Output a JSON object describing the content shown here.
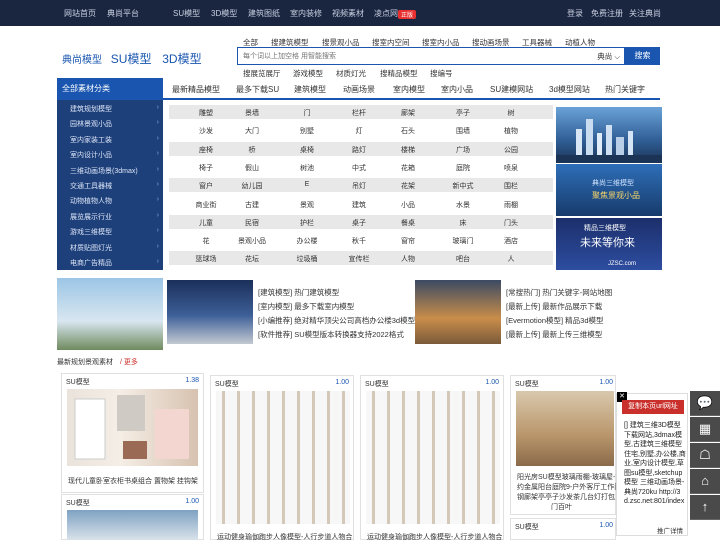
{
  "topbar": {
    "links": [
      "网站首页",
      "典尚平台",
      "SU模型",
      "3D模型",
      "建筑图纸",
      "室内装修",
      "视频素材",
      "凌点网"
    ],
    "hot_badge": "正版",
    "right": [
      "登录",
      "免费注册",
      "关注典尚"
    ]
  },
  "logo": {
    "brand": "典尚模型",
    "su": "SU模型",
    "d3": "3D模型"
  },
  "search": {
    "categories": [
      "全部",
      "搜建筑模型",
      "搜景观小品",
      "搜室内空间",
      "搜室内小品",
      "搜动画场景",
      "工具器械",
      "动植人物"
    ],
    "placeholder": "每个词以上加空格 用智能搜索",
    "select": "典尚",
    "button": "搜索",
    "sub": [
      "搜展览展厅",
      "游戏模型",
      "材质灯光",
      "搜精品模型",
      "搜编号"
    ]
  },
  "nav": {
    "all": "全部素材分类",
    "items": [
      "最新精品模型",
      "最多下载SU",
      "建筑模型",
      "动画场景",
      "室内模型",
      "室内小品",
      "SU建模网站",
      "3d模型网站",
      "热门关键字"
    ]
  },
  "sidebar": [
    "建筑规划模型",
    "园林景观小品",
    "室内家装工装",
    "室内设计小品",
    "三维动画场景(3dmax)",
    "交通工具器械",
    "动物植物人物",
    "展览展示行业",
    "游戏三维模型",
    "材质贴图灯光",
    "电商广告精品"
  ],
  "tags": [
    [
      "雕塑",
      "景墙",
      "门",
      "栏杆",
      "廊架",
      "亭子",
      "树"
    ],
    [
      "沙发",
      "大门",
      "别墅",
      "灯",
      "石头",
      "围墙",
      "植物"
    ],
    [
      "座椅",
      "桥",
      "桌椅",
      "路灯",
      "楼梯",
      "广场",
      "公园"
    ],
    [
      "椅子",
      "假山",
      "树池",
      "中式",
      "花箱",
      "庭院",
      "喷泉"
    ],
    [
      "窗户",
      "幼儿园",
      "E",
      "吊灯",
      "花架",
      "新中式",
      "围栏"
    ],
    [
      "商业街",
      "古建",
      "景观",
      "建筑",
      "小品",
      "水景",
      "雨棚"
    ],
    [
      "儿童",
      "民宿",
      "护栏",
      "桌子",
      "餐桌",
      "床",
      "门头"
    ],
    [
      "花",
      "景观小品",
      "办公楼",
      "秋千",
      "窗帘",
      "玻璃门",
      "酒店"
    ],
    [
      "篮球场",
      "花坛",
      "垃圾桶",
      "宣传栏",
      "人物",
      "吧台",
      "人"
    ]
  ],
  "banners": {
    "b2_line1": "典尚三维模型",
    "b2_line2": "聚焦景观小品",
    "b3_line1": "精品三维模型",
    "b3_line2": "未来等你来",
    "b3_logo": "JZSC.com"
  },
  "news": {
    "left": [
      "[建筑模型]  热门建筑模型",
      "[室内模型]  最多下载室内模型",
      "[小编推荐]  绝对精华顶尖公司高档办公楼3d模型",
      "[软件推荐]  SU模型版本转换器支持2022格式"
    ],
    "right": [
      "[常搜热门]  热门关键字-网站地图",
      "[最新上传]  最新作品展示下载",
      "[Evermotion模型]  精品3d模型",
      "[最新上传]  最新上传三维模型"
    ]
  },
  "section": {
    "title": "最新规划景观素材",
    "more": "/ 更多"
  },
  "cards": [
    {
      "type": "SU模型",
      "ver": "1.38",
      "caption": "现代儿童卧室衣柜书桌组合 置物架 挂钩架"
    },
    {
      "type": "SU模型",
      "ver": "1.00",
      "caption": "运动健身瑜伽跑步人像模型-人行步道人物合"
    },
    {
      "type": "SU模型",
      "ver": "1.00",
      "caption": "运动健身瑜伽跑步人像模型-人行步道人物合"
    },
    {
      "type": "SU模型",
      "ver": "1.00",
      "caption_l1": "阳光房SU模型玻璃雨棚-玻璃屋-简",
      "caption_l2": "约金属阳台庭院9-户外客厅工作间",
      "caption_l3": "钢廊架亭亭子沙发茶几台灯打包",
      "caption_l4": "门百叶"
    },
    {
      "type": "SU模型",
      "ver": "1.00"
    },
    {
      "type": "SU模型",
      "ver": "1.00"
    }
  ],
  "popup": {
    "close": "✕",
    "button": "复制本页url网址",
    "text": "[] 建筑三维3D模型下载网站,3dmax模型,古建筑三维模型住宅,别墅,办公楼,商业,室内设计模型,草图su模型,sketchup模型 三维动画场景-典尚720ku http://3d.zsc.net:801/index",
    "footer": "推广详情"
  },
  "toolbar": [
    "💬",
    "▦",
    "☖",
    "⌂",
    "↑"
  ]
}
